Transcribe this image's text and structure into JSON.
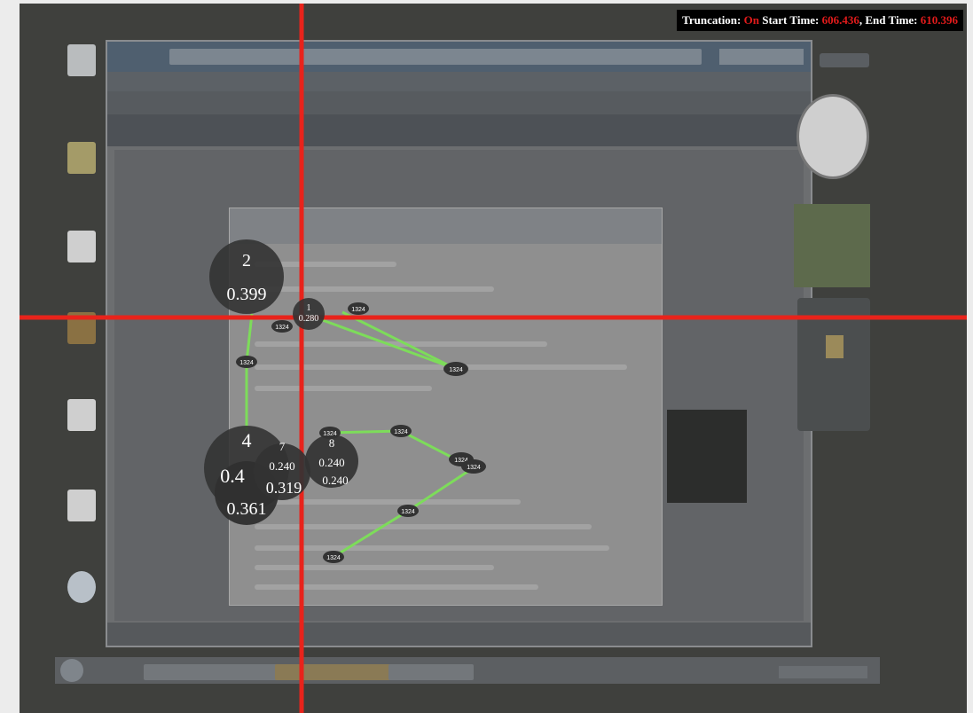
{
  "truncation": {
    "label": "Truncation:",
    "state": "On",
    "start_label": "Start Time:",
    "start_value": "606.436",
    "end_label": ", End Time:",
    "end_value": "610.396"
  },
  "crosshair": {
    "color": "#e8231b"
  },
  "fixations": {
    "big": [
      {
        "index": "2",
        "value": "0.399"
      },
      {
        "index": "1",
        "value": "0.280"
      },
      {
        "index": "4",
        "value": "0.4",
        "sub": "0.361"
      },
      {
        "index": "7",
        "value": "0.240",
        "sub": "0.319"
      },
      {
        "index": "8",
        "value": "0.240",
        "sub": "0.240"
      }
    ],
    "path_color": "#7ddc5a",
    "point_label": "1324"
  }
}
